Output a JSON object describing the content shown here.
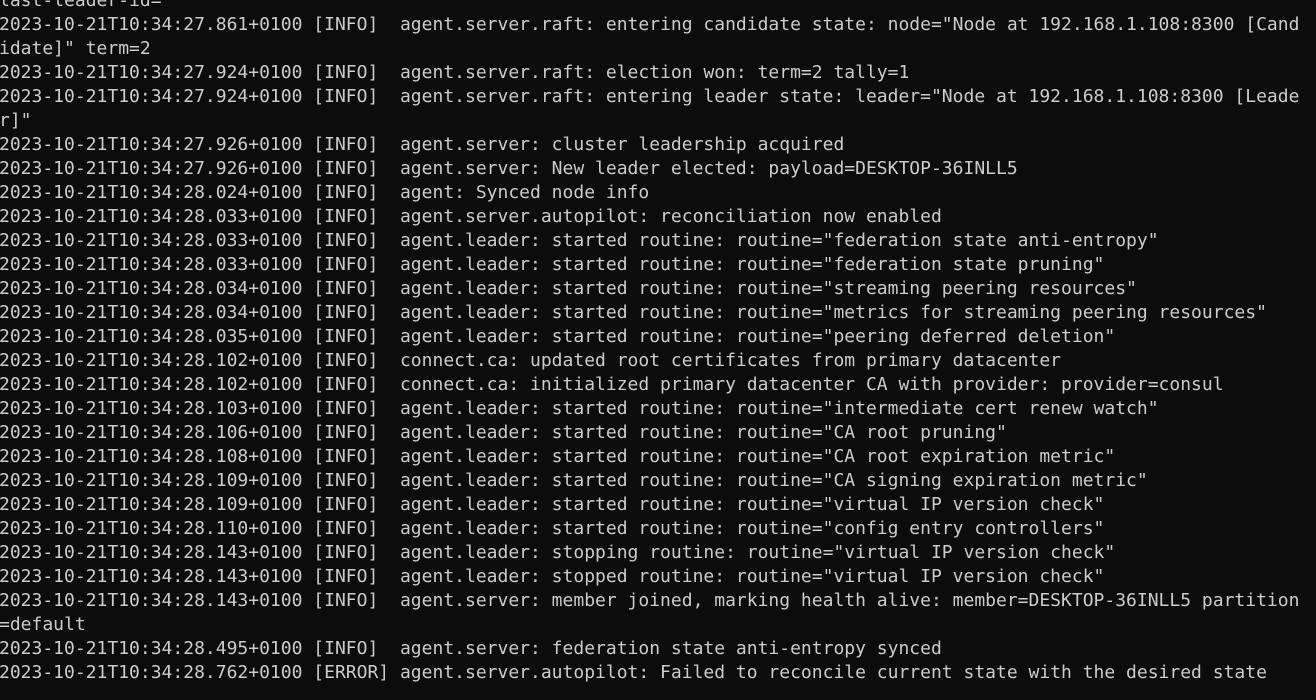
{
  "terminal": {
    "lines": [
      "last-leader-id=",
      "2023-10-21T10:34:27.861+0100 [INFO]  agent.server.raft: entering candidate state: node=\"Node at 192.168.1.108:8300 [Cand",
      "idate]\" term=2",
      "2023-10-21T10:34:27.924+0100 [INFO]  agent.server.raft: election won: term=2 tally=1",
      "2023-10-21T10:34:27.924+0100 [INFO]  agent.server.raft: entering leader state: leader=\"Node at 192.168.1.108:8300 [Leade",
      "r]\"",
      "2023-10-21T10:34:27.926+0100 [INFO]  agent.server: cluster leadership acquired",
      "2023-10-21T10:34:27.926+0100 [INFO]  agent.server: New leader elected: payload=DESKTOP-36INLL5",
      "2023-10-21T10:34:28.024+0100 [INFO]  agent: Synced node info",
      "2023-10-21T10:34:28.033+0100 [INFO]  agent.server.autopilot: reconciliation now enabled",
      "2023-10-21T10:34:28.033+0100 [INFO]  agent.leader: started routine: routine=\"federation state anti-entropy\"",
      "2023-10-21T10:34:28.033+0100 [INFO]  agent.leader: started routine: routine=\"federation state pruning\"",
      "2023-10-21T10:34:28.034+0100 [INFO]  agent.leader: started routine: routine=\"streaming peering resources\"",
      "2023-10-21T10:34:28.034+0100 [INFO]  agent.leader: started routine: routine=\"metrics for streaming peering resources\"",
      "2023-10-21T10:34:28.035+0100 [INFO]  agent.leader: started routine: routine=\"peering deferred deletion\"",
      "2023-10-21T10:34:28.102+0100 [INFO]  connect.ca: updated root certificates from primary datacenter",
      "2023-10-21T10:34:28.102+0100 [INFO]  connect.ca: initialized primary datacenter CA with provider: provider=consul",
      "2023-10-21T10:34:28.103+0100 [INFO]  agent.leader: started routine: routine=\"intermediate cert renew watch\"",
      "2023-10-21T10:34:28.106+0100 [INFO]  agent.leader: started routine: routine=\"CA root pruning\"",
      "2023-10-21T10:34:28.108+0100 [INFO]  agent.leader: started routine: routine=\"CA root expiration metric\"",
      "2023-10-21T10:34:28.109+0100 [INFO]  agent.leader: started routine: routine=\"CA signing expiration metric\"",
      "2023-10-21T10:34:28.109+0100 [INFO]  agent.leader: started routine: routine=\"virtual IP version check\"",
      "2023-10-21T10:34:28.110+0100 [INFO]  agent.leader: started routine: routine=\"config entry controllers\"",
      "2023-10-21T10:34:28.143+0100 [INFO]  agent.leader: stopping routine: routine=\"virtual IP version check\"",
      "2023-10-21T10:34:28.143+0100 [INFO]  agent.leader: stopped routine: routine=\"virtual IP version check\"",
      "2023-10-21T10:34:28.143+0100 [INFO]  agent.server: member joined, marking health alive: member=DESKTOP-36INLL5 partition",
      "=default",
      "2023-10-21T10:34:28.495+0100 [INFO]  agent.server: federation state anti-entropy synced",
      "2023-10-21T10:34:28.762+0100 [ERROR] agent.server.autopilot: Failed to reconcile current state with the desired state"
    ]
  }
}
